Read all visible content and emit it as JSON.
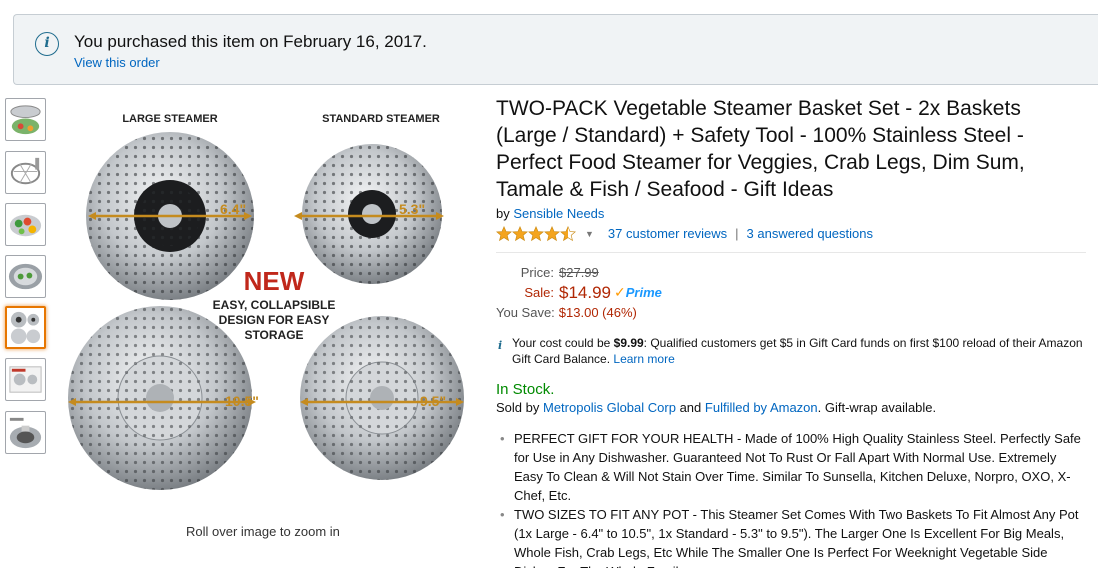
{
  "banner": {
    "icon": "info-icon",
    "text": "You purchased this item on February 16, 2017.",
    "link": "View this order"
  },
  "gallery": {
    "thumbnails": [
      "thumb-1",
      "thumb-2",
      "thumb-3",
      "thumb-4",
      "thumb-5",
      "thumb-6",
      "thumb-7"
    ],
    "active_index": 4,
    "labels": {
      "large": "LARGE STEAMER",
      "standard": "STANDARD STEAMER",
      "new": "NEW",
      "new_sub_1": "EASY, COLLAPSIBLE",
      "new_sub_2": "DESIGN FOR EASY",
      "new_sub_3": "STORAGE",
      "dim_large_closed": "6.4\"",
      "dim_std_closed": "5.3\"",
      "dim_large_open": "10.5\"",
      "dim_std_open": "9.5\""
    },
    "caption": "Roll over image to zoom in"
  },
  "product": {
    "title": "TWO-PACK Vegetable Steamer Basket Set - 2x Baskets (Large / Standard) + Safety Tool - 100% Stainless Steel - Perfect Food Steamer for Veggies, Crab Legs, Dim Sum, Tamale & Fish / Seafood - Gift Ideas",
    "by_label": "by",
    "brand": "Sensible Needs",
    "rating_stars": 4.5,
    "reviews": "37 customer reviews",
    "separator": "|",
    "questions": "3 answered questions",
    "price_label": "Price:",
    "list_price": "$27.99",
    "sale_label": "Sale:",
    "sale_price": "$14.99",
    "prime_check": "✓",
    "prime_text": "Prime",
    "save_label": "You Save:",
    "save_value": "$13.00 (46%)",
    "gift_pre": "Your cost could be",
    "gift_price": "$9.99",
    "gift_post": ": Qualified customers get $5 in Gift Card funds on first $100 reload of their Amazon Gift Card Balance.",
    "gift_link": "Learn more",
    "stock": "In Stock.",
    "sold_by_label": "Sold by",
    "seller": "Metropolis Global Corp",
    "and": "and",
    "fulfilled": "Fulfilled by Amazon",
    "gift_wrap": ". Gift-wrap available.",
    "bullets": [
      "PERFECT GIFT FOR YOUR HEALTH - Made of 100% High Quality Stainless Steel. Perfectly Safe for Use in Any Dishwasher. Guaranteed Not To Rust Or Fall Apart With Normal Use. Extremely Easy To Clean & Will Not Stain Over Time. Similar To Sunsella, Kitchen Deluxe, Norpro, OXO, X-Chef, Etc.",
      "TWO SIZES TO FIT ANY POT - This Steamer Set Comes With Two Baskets To Fit Almost Any Pot (1x Large - 6.4\" to 10.5\", 1x Standard - 5.3\" to 9.5\"). The Larger One Is Excellent For Big Meals, Whole Fish, Crab Legs, Etc While The Smaller One Is Perfect For Weeknight Vegetable Side Dishes For The Whole Family."
    ]
  },
  "colors": {
    "link": "#0066c0",
    "price": "#b12704",
    "stock": "#008a00",
    "prime": "#1a98ff",
    "star": "#f4a41d",
    "thumb_active": "#e77600"
  }
}
